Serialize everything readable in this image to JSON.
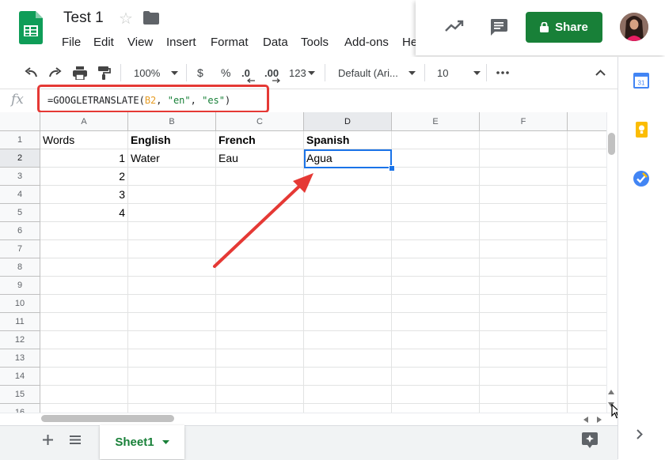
{
  "doc": {
    "title": "Test 1"
  },
  "menu": [
    "File",
    "Edit",
    "View",
    "Insert",
    "Format",
    "Data",
    "Tools",
    "Add-ons",
    "He"
  ],
  "header": {
    "share_label": "Share"
  },
  "toolbar": {
    "zoom": "100%",
    "currency": "$",
    "percent": "%",
    "decrease_decimal": ".0",
    "increase_decimal": ".00",
    "more_formats": "123",
    "font": "Default (Ari...",
    "font_size": "10"
  },
  "formula_bar": {
    "fx": "fx",
    "formula_prefix": "=GOOGLETRANSLATE(",
    "formula_ref": "B2",
    "formula_sep1": ", ",
    "formula_arg1": "\"en\"",
    "formula_sep2": ", ",
    "formula_arg2": "\"es\"",
    "formula_suffix": ")"
  },
  "columns": [
    "A",
    "B",
    "C",
    "D",
    "E",
    "F"
  ],
  "rows": [
    "1",
    "2",
    "3",
    "4",
    "5",
    "6",
    "7",
    "8",
    "9",
    "10",
    "11",
    "12",
    "13",
    "14",
    "15",
    "16"
  ],
  "cells": {
    "A1": "Words",
    "B1": "English",
    "C1": "French",
    "D1": "Spanish",
    "A2": "1",
    "B2": "Water",
    "C2": "Eau",
    "D2": "Agua",
    "A3": "2",
    "A4": "3",
    "A5": "4"
  },
  "selected_cell": "D2",
  "sheets": [
    {
      "label": "Sheet1",
      "active": true
    }
  ],
  "colors": {
    "accent": "#188038",
    "selection": "#1a73e8",
    "annotation": "#e53935"
  }
}
